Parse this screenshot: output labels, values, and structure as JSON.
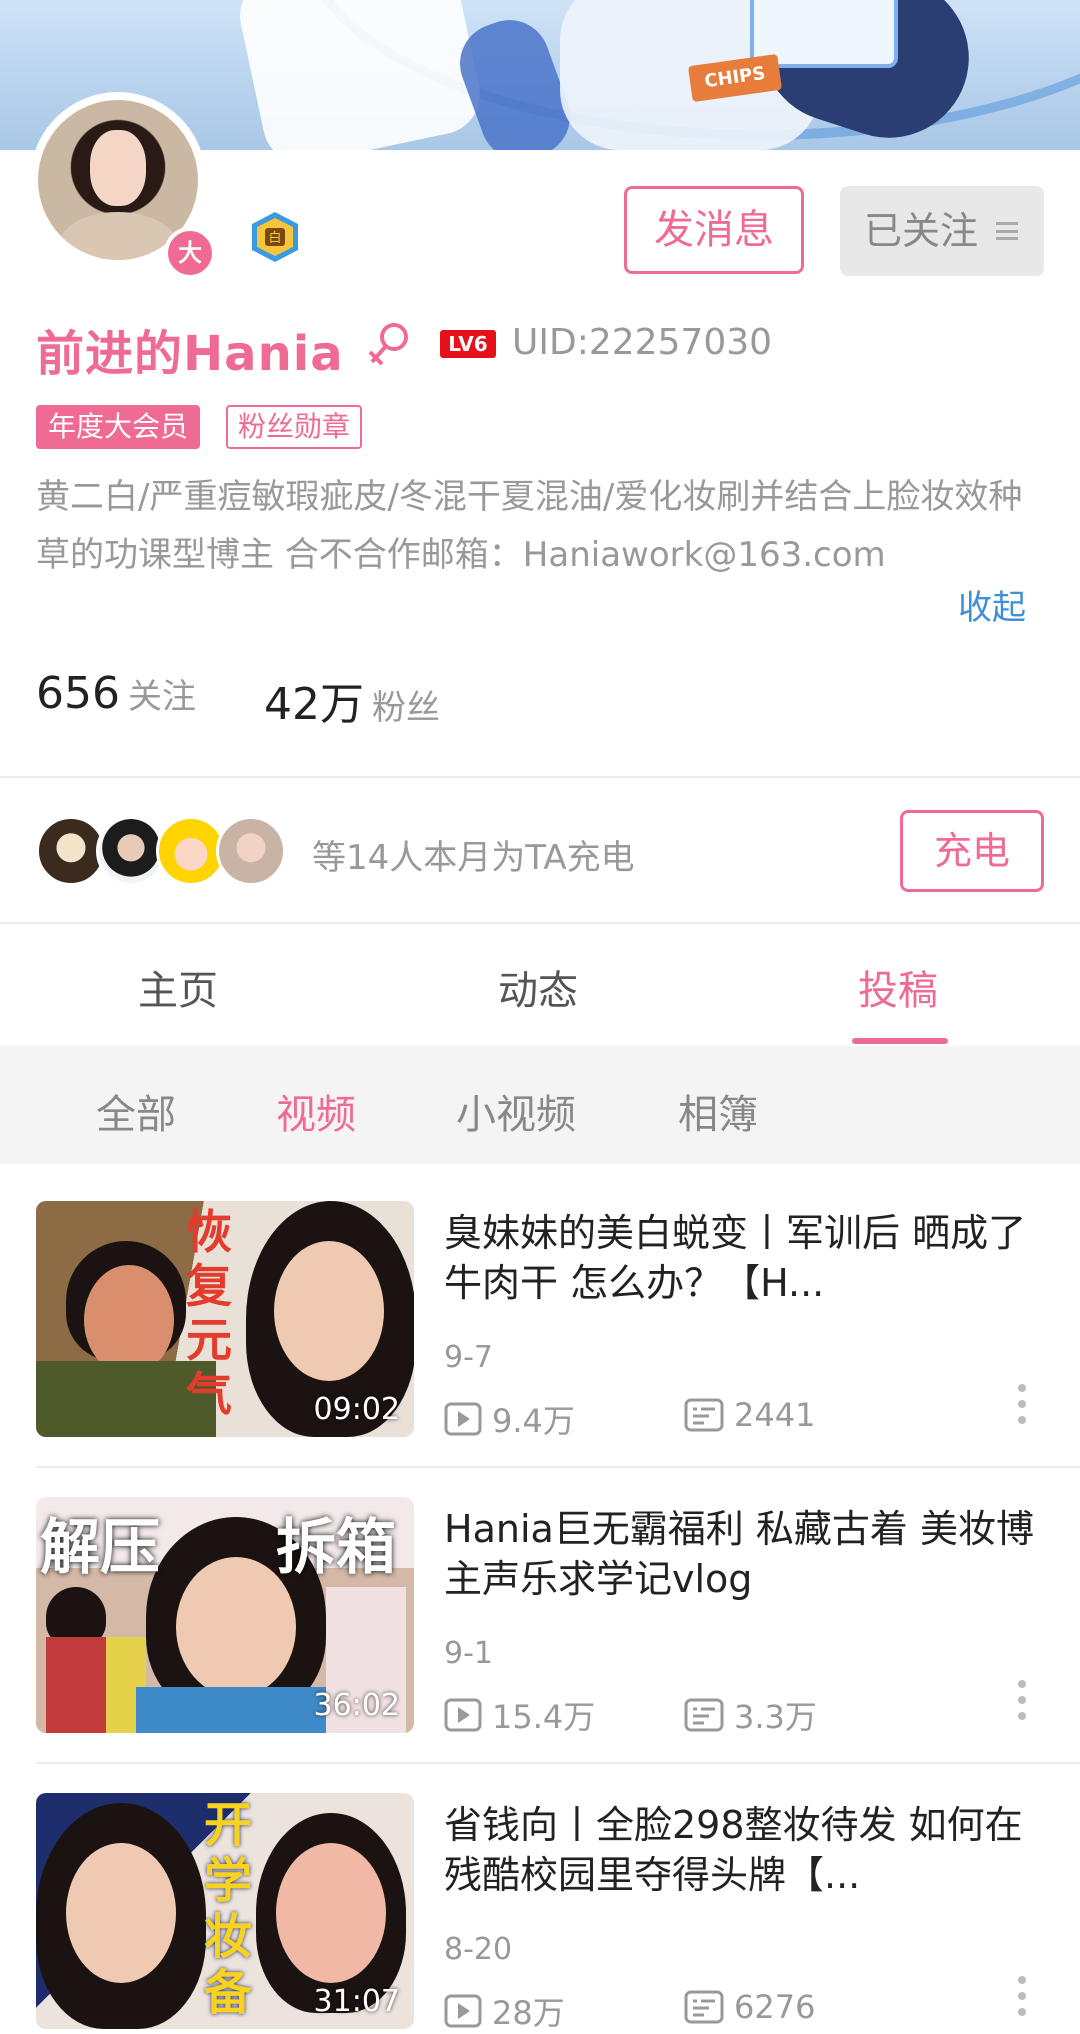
{
  "profile": {
    "name": "前进的Hania",
    "avatar_badge": "大",
    "level": "LV6",
    "uid": "UID:22257030",
    "vip_tag": "年度大会员",
    "fan_badge": "粉丝勋章",
    "bio": "黄二白/严重痘敏瑕疵皮/冬混干夏混油/爱化妆刷并结合上脸妆效种草的功课型博主 合不合作邮箱：Haniawork@163.com",
    "collapse_label": "收起",
    "following_count": "656",
    "following_label": "关注",
    "followers_count": "42万",
    "followers_label": "粉丝"
  },
  "header_buttons": {
    "message": "发消息",
    "followed": "已关注"
  },
  "banner": {
    "chips_text": "CHIPS"
  },
  "charge": {
    "text": "等14人本月为TA充电",
    "button": "充电"
  },
  "tabs": [
    "主页",
    "动态",
    "投稿"
  ],
  "active_tab": "投稿",
  "subtabs": [
    "全部",
    "视频",
    "小视频",
    "相簿"
  ],
  "active_subtab": "视频",
  "videos": [
    {
      "title": "臭妹妹的美白蜕变丨军训后 晒成了牛肉干 怎么办？【H...",
      "duration": "09:02",
      "date": "9-7",
      "plays": "9.4万",
      "comments": "2441",
      "thumb_text": "恢复元气"
    },
    {
      "title": "Hania巨无霸福利 私藏古着 美妆博主声乐求学记vlog",
      "duration": "36:02",
      "date": "9-1",
      "plays": "15.4万",
      "comments": "3.3万",
      "thumb_text_left": "解压",
      "thumb_text_right": "拆箱"
    },
    {
      "title": "省钱向丨全脸298整妆待发 如何在残酷校园里夺得头牌【...",
      "duration": "31:07",
      "date": "8-20",
      "plays": "28万",
      "comments": "6276",
      "thumb_text": "开学妆备"
    }
  ],
  "colors": {
    "accent": "#f06b93",
    "link": "#3f8fd6",
    "muted": "#999999"
  }
}
